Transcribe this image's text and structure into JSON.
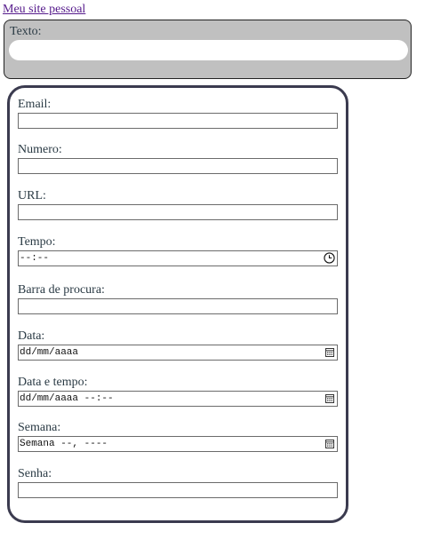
{
  "header": {
    "site_link": "Meu site pessoal"
  },
  "texto_section": {
    "label": "Texto:",
    "value": ""
  },
  "form": {
    "email": {
      "label": "Email:",
      "value": ""
    },
    "numero": {
      "label": "Numero:",
      "value": ""
    },
    "url": {
      "label": "URL:",
      "value": ""
    },
    "tempo": {
      "label": "Tempo:",
      "placeholder": "--:--",
      "icon": "clock-icon"
    },
    "barra": {
      "label": "Barra de procura:",
      "value": ""
    },
    "data": {
      "label": "Data:",
      "placeholder": "dd/mm/aaaa",
      "icon": "calendar-icon"
    },
    "data_tempo": {
      "label": "Data e tempo:",
      "placeholder": "dd/mm/aaaa --:--",
      "icon": "calendar-icon"
    },
    "semana": {
      "label": "Semana:",
      "placeholder": "Semana --, ----",
      "icon": "calendar-icon"
    },
    "senha": {
      "label": "Senha:",
      "value": ""
    }
  },
  "colors": {
    "link": "#551a8b",
    "texto_box_bg": "#c0c0c0",
    "form_border": "#3b3b4f"
  }
}
